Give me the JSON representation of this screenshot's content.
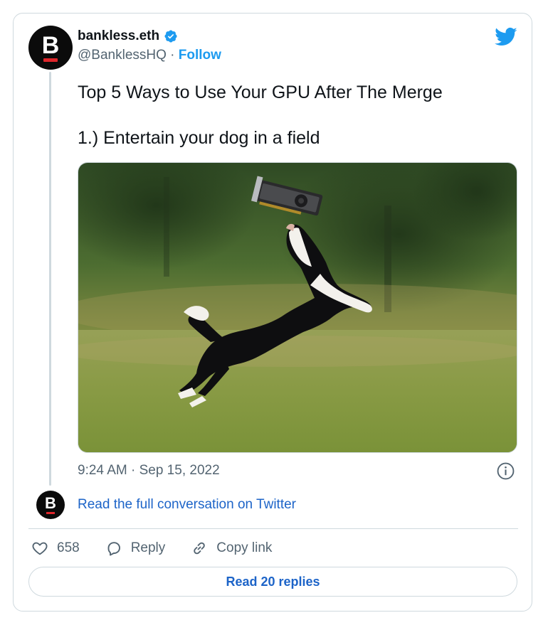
{
  "author": {
    "name": "bankless.eth",
    "handle": "@BanklessHQ",
    "separator": "·",
    "follow_label": "Follow",
    "avatar_letter": "B",
    "avatar_bg": "#0b0b0b",
    "avatar_accent": "#e0262b"
  },
  "tweet": {
    "line1": "Top 5 Ways to Use Your GPU After The Merge",
    "line2": "1.) Entertain your dog in a field",
    "timestamp": "9:24 AM · Sep 15, 2022"
  },
  "conversation": {
    "link_label": "Read the full conversation on Twitter"
  },
  "actions": {
    "like_count": "658",
    "reply_label": "Reply",
    "copy_link_label": "Copy link"
  },
  "footer": {
    "read_replies_label": "Read 20 replies"
  },
  "icons": {
    "brand": "twitter-bird-icon",
    "verified": "verified-badge-icon",
    "info": "info-icon",
    "like": "heart-icon",
    "reply": "speech-bubble-icon",
    "copy_link": "chain-link-icon"
  },
  "colors": {
    "accent": "#1d9bf0",
    "link": "#1d64c8",
    "muted": "#536471",
    "border": "#cfd9de"
  }
}
